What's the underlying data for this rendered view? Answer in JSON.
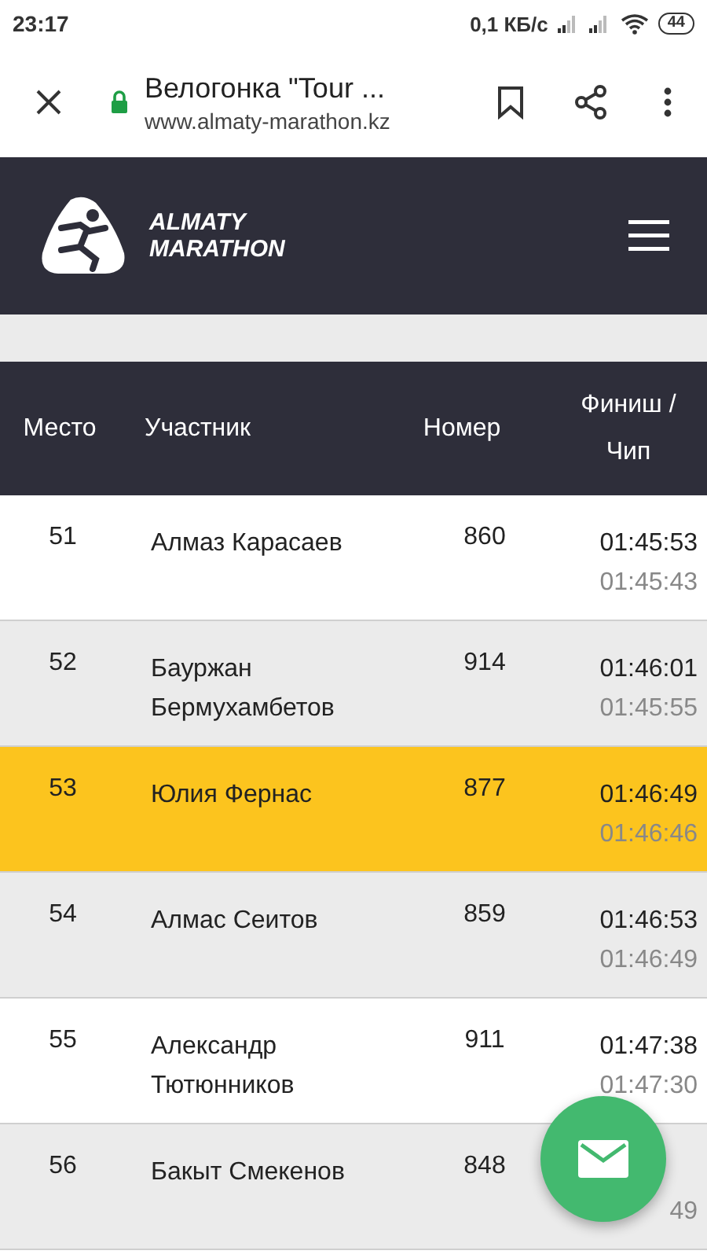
{
  "status_bar": {
    "time": "23:17",
    "speed": "0,1 КБ/с",
    "battery": "44"
  },
  "browser": {
    "title": "Велогонка \"Tour ...",
    "url": "www.almaty-marathon.kz",
    "secure": true
  },
  "site_header": {
    "logo_line_1": "ALMATY",
    "logo_line_2": "MARATHON"
  },
  "table": {
    "columns": [
      "Место",
      "Участник",
      "Номер",
      "Финиш / Чип"
    ],
    "rows": [
      {
        "place": "51",
        "name": "Алмаз Карасаев",
        "number": "860",
        "finish": "01:45:53",
        "chip": "01:45:43",
        "highlighted": false
      },
      {
        "place": "52",
        "name": "Бауржан Бермухамбетов",
        "number": "914",
        "finish": "01:46:01",
        "chip": "01:45:55",
        "highlighted": false
      },
      {
        "place": "53",
        "name": "Юлия Фернас",
        "number": "877",
        "finish": "01:46:49",
        "chip": "01:46:46",
        "highlighted": true
      },
      {
        "place": "54",
        "name": "Алмас Сеитов",
        "number": "859",
        "finish": "01:46:53",
        "chip": "01:46:49",
        "highlighted": false
      },
      {
        "place": "55",
        "name": "Александр Тютюнников",
        "number": "911",
        "finish": "01:47:38",
        "chip": "01:47:30",
        "highlighted": false
      },
      {
        "place": "56",
        "name": "Бакыт Смекенов",
        "number": "848",
        "chip": "49",
        "highlighted": false
      }
    ]
  }
}
